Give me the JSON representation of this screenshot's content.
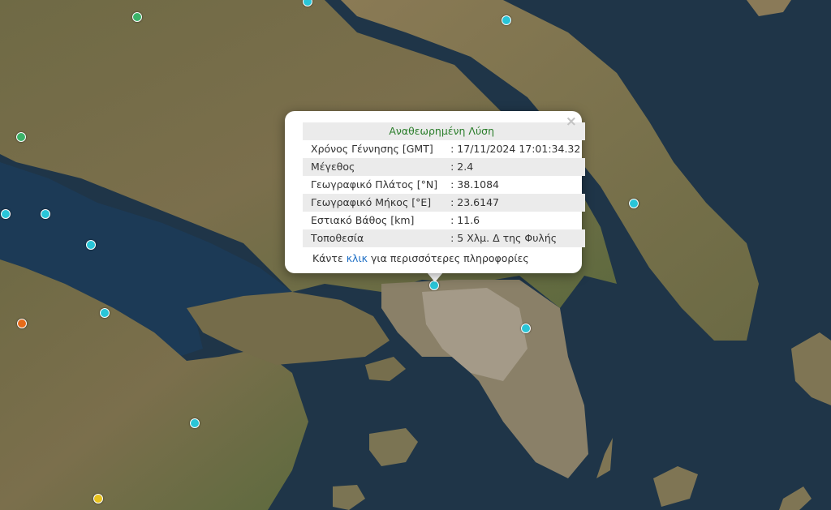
{
  "popup": {
    "title": "Αναθεωρημένη Λύση",
    "close_symbol": "×",
    "rows": [
      {
        "label": "Χρόνος Γέννησης [GMT]",
        "value": ": 17/11/2024 17:01:34.32"
      },
      {
        "label": "Μέγεθος",
        "value": ": 2.4"
      },
      {
        "label": "Γεωγραφικό Πλάτος [°N]",
        "value": ": 38.1084"
      },
      {
        "label": "Γεωγραφικό Μήκος [°E]",
        "value": ": 23.6147"
      },
      {
        "label": "Εστιακό Βάθος [km]",
        "value": ": 11.6"
      },
      {
        "label": "Τοποθεσία",
        "value": ": 5 Χλμ. Δ της Φυλής"
      }
    ],
    "more_prefix": "Κάντε ",
    "more_link": "κλικ",
    "more_suffix": " για περισσότερες πληροφορίες"
  },
  "colors": {
    "marker_cyan": "#29c5d8",
    "marker_green": "#3bb36a",
    "marker_orange": "#e66b1a",
    "marker_yellow": "#e8c21d",
    "popup_title": "#2a7d2a",
    "link": "#1f6fc5"
  },
  "markers": [
    {
      "name": "earthquake-marker-selected",
      "color": "marker_cyan"
    },
    {
      "name": "earthquake-marker",
      "color": "marker_cyan"
    },
    {
      "name": "earthquake-marker",
      "color": "marker_cyan"
    },
    {
      "name": "earthquake-marker",
      "color": "marker_cyan"
    },
    {
      "name": "earthquake-marker",
      "color": "marker_cyan"
    },
    {
      "name": "earthquake-marker",
      "color": "marker_cyan"
    },
    {
      "name": "earthquake-marker",
      "color": "marker_cyan"
    },
    {
      "name": "earthquake-marker",
      "color": "marker_cyan"
    },
    {
      "name": "earthquake-marker",
      "color": "marker_cyan"
    },
    {
      "name": "earthquake-marker",
      "color": "marker_cyan"
    },
    {
      "name": "earthquake-marker",
      "color": "marker_green"
    },
    {
      "name": "earthquake-marker",
      "color": "marker_green"
    },
    {
      "name": "earthquake-marker",
      "color": "marker_orange"
    },
    {
      "name": "earthquake-marker",
      "color": "marker_yellow"
    }
  ]
}
